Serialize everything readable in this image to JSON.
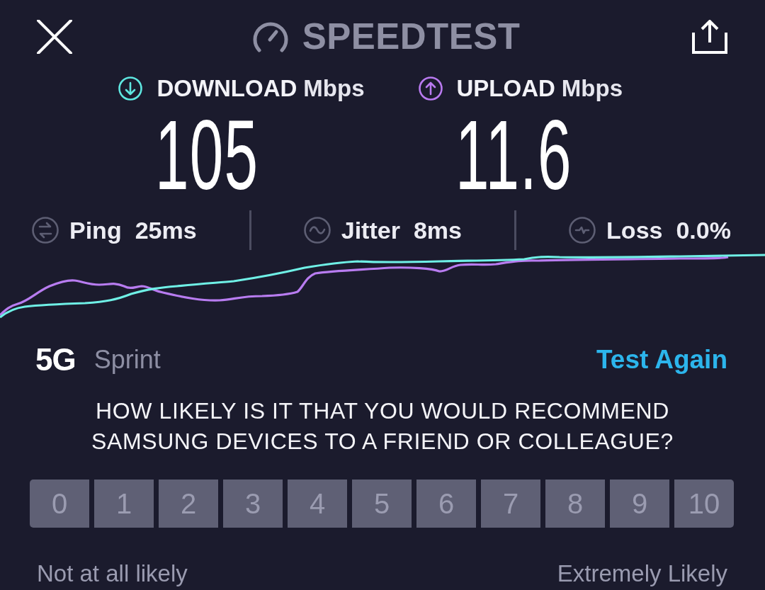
{
  "header": {
    "title": "SPEEDTEST"
  },
  "results": [
    {
      "kind": "download",
      "label": "DOWNLOAD",
      "unit": "Mbps",
      "value": "105"
    },
    {
      "kind": "upload",
      "label": "UPLOAD",
      "unit": "Mbps",
      "value": "11.6"
    }
  ],
  "stats": [
    {
      "kind": "ping",
      "label": "Ping",
      "value": "25ms"
    },
    {
      "kind": "jitter",
      "label": "Jitter",
      "value": "8ms"
    },
    {
      "kind": "loss",
      "label": "Loss",
      "value": "0.0%"
    }
  ],
  "connection": {
    "network_type": "5G",
    "carrier": "Sprint",
    "action": "Test Again"
  },
  "survey": {
    "question": "HOW LIKELY IS IT THAT YOU WOULD RECOMMEND SAMSUNG DEVICES TO A FRIEND OR COLLEAGUE?",
    "options": [
      "0",
      "1",
      "2",
      "3",
      "4",
      "5",
      "6",
      "7",
      "8",
      "9",
      "10"
    ],
    "low_label": "Not at all likely",
    "high_label": "Extremely Likely"
  }
}
